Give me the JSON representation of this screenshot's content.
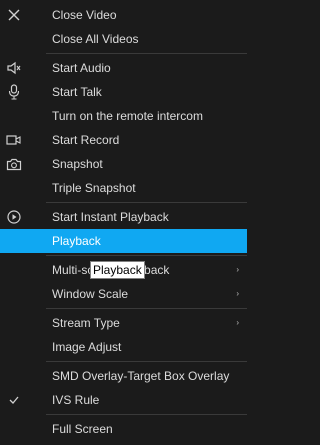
{
  "menu": {
    "items": [
      {
        "label": "Close Video"
      },
      {
        "label": "Close All Videos"
      },
      {
        "label": "Start Audio"
      },
      {
        "label": "Start Talk"
      },
      {
        "label": "Turn on the remote intercom"
      },
      {
        "label": "Start Record"
      },
      {
        "label": "Snapshot"
      },
      {
        "label": "Triple Snapshot"
      },
      {
        "label": "Start Instant Playback"
      },
      {
        "label": "Playback"
      },
      {
        "label": "Multi-screen Playback"
      },
      {
        "label": "Window Scale"
      },
      {
        "label": "Stream Type"
      },
      {
        "label": "Image Adjust"
      },
      {
        "label": "SMD Overlay-Target Box Overlay"
      },
      {
        "label": "IVS Rule"
      },
      {
        "label": "Full Screen"
      }
    ],
    "active_item": "Playback",
    "submenu_arrow": "›"
  },
  "tooltip": {
    "text": "Playback"
  },
  "icons": {
    "close": "close-icon",
    "audio": "speaker-icon",
    "talk": "microphone-icon",
    "record": "video-camera-icon",
    "snapshot": "camera-icon",
    "instant_playback": "play-circle-icon",
    "ivs_rule": "check-icon"
  },
  "colors": {
    "background": "#1b1b1b",
    "highlight": "#10a8f2",
    "text": "#dcdcdc"
  }
}
